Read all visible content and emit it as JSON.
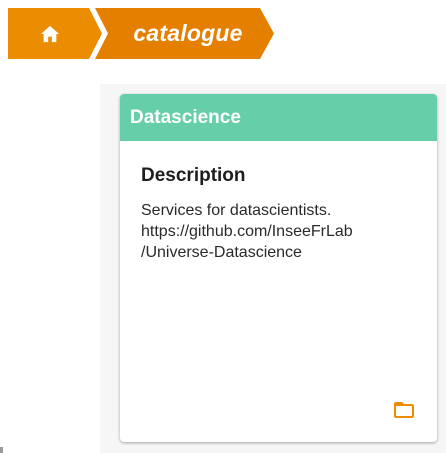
{
  "breadcrumb": {
    "home_icon": "home-icon",
    "current_label": "catalogue"
  },
  "card": {
    "title": "Datascience",
    "description_heading": "Description",
    "description_lines": [
      "Services for datascientists.",
      "https://github.com/InseeFrLab",
      "/Universe-Datascience"
    ],
    "action_icon": "folder-icon"
  },
  "colors": {
    "breadcrumb_home_bg": "#ec8c00",
    "breadcrumb_current_bg": "#e57f00",
    "card_header_bg": "#66cfa9",
    "accent_icon": "#ec8c00",
    "content_bg": "#f6f6f6"
  }
}
